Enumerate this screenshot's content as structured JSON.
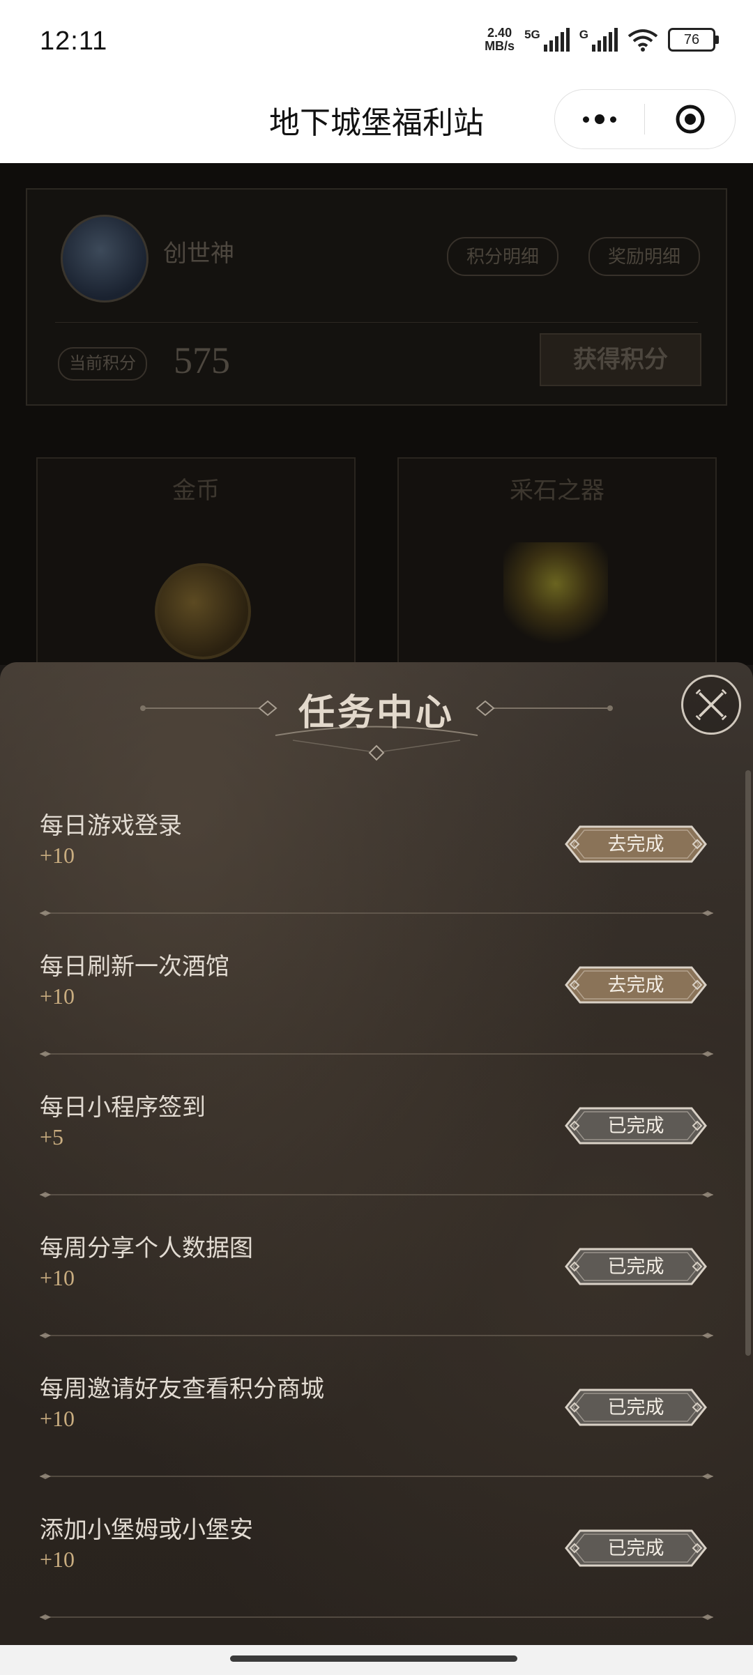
{
  "status_bar": {
    "time": "12:11",
    "net_speed_top": "2.40",
    "net_speed_bottom": "MB/s",
    "signal1_label": "5G",
    "signal2_label": "G",
    "battery": "76"
  },
  "nav": {
    "title": "地下城堡福利站"
  },
  "profile": {
    "username": "创世神",
    "points_detail_label": "积分明细",
    "reward_detail_label": "奖励明细",
    "current_points_label": "当前积分",
    "current_points": "575",
    "earn_points_label": "获得积分"
  },
  "shop_cards": [
    {
      "title": "金币"
    },
    {
      "title": "采石之器"
    }
  ],
  "task_center": {
    "title": "任务中心",
    "tasks": [
      {
        "name": "每日游戏登录",
        "points": "+10",
        "button": "去完成",
        "state": "todo"
      },
      {
        "name": "每日刷新一次酒馆",
        "points": "+10",
        "button": "去完成",
        "state": "todo"
      },
      {
        "name": "每日小程序签到",
        "points": "+5",
        "button": "已完成",
        "state": "done"
      },
      {
        "name": "每周分享个人数据图",
        "points": "+10",
        "button": "已完成",
        "state": "done"
      },
      {
        "name": "每周邀请好友查看积分商城",
        "points": "+10",
        "button": "已完成",
        "state": "done"
      },
      {
        "name": "添加小堡姆或小堡安",
        "points": "+10",
        "button": "已完成",
        "state": "done"
      }
    ]
  },
  "colors": {
    "todo_button": "#8a7358",
    "done_button": "#5e5a55",
    "points_text": "#c9ad80"
  }
}
